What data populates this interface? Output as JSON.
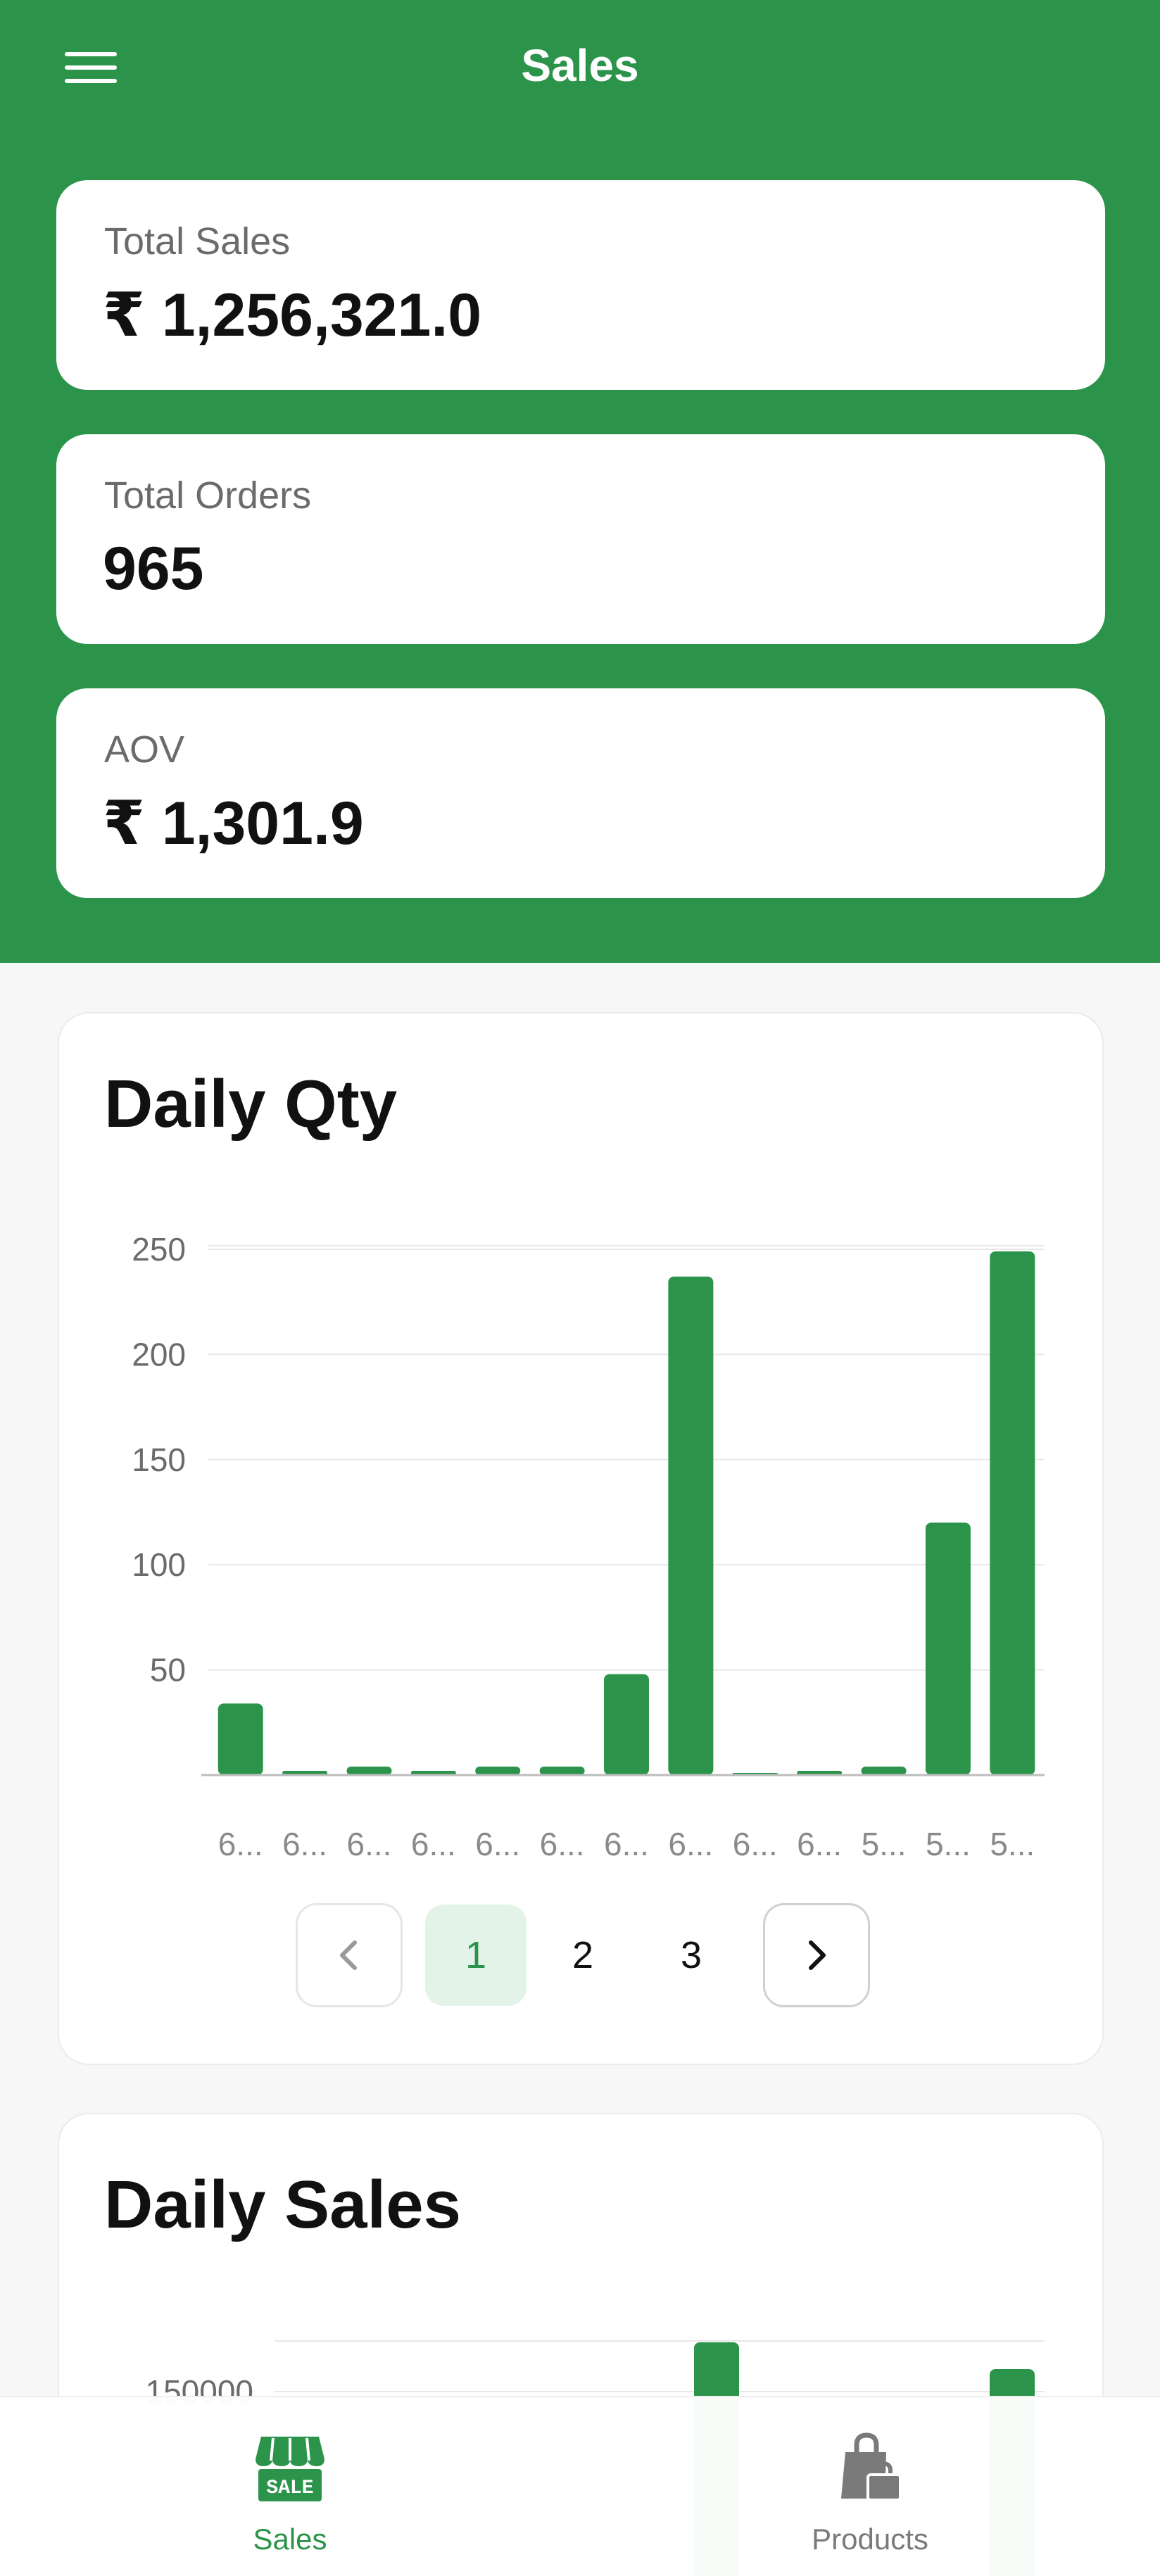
{
  "header": {
    "title": "Sales",
    "menu_icon": "hamburger-menu-icon"
  },
  "stats": [
    {
      "label": "Total Sales",
      "value": "₹ 1,256,321.0"
    },
    {
      "label": "Total Orders",
      "value": "965"
    },
    {
      "label": "AOV",
      "value": "₹ 1,301.9"
    }
  ],
  "daily_qty": {
    "title": "Daily Qty",
    "pagination": {
      "prev_icon": "chevron-left-icon",
      "next_icon": "chevron-right-icon",
      "pages": [
        "1",
        "2",
        "3"
      ],
      "current": "1"
    }
  },
  "daily_sales": {
    "title": "Daily Sales"
  },
  "nav": [
    {
      "label": "Sales",
      "icon": "sale-store-icon",
      "active": true
    },
    {
      "label": "Products",
      "icon": "shopping-bags-icon",
      "active": false
    }
  ],
  "colors": {
    "brand": "#2c944a",
    "active_page_bg": "#e4f3e8",
    "inactive_nav": "#7a7a7a"
  },
  "chart_data": [
    {
      "type": "bar",
      "title": "Daily Qty",
      "categories": [
        "6...",
        "6...",
        "6...",
        "6...",
        "6...",
        "6...",
        "6...",
        "6...",
        "6...",
        "6...",
        "5...",
        "5...",
        "5..."
      ],
      "values": [
        34,
        2,
        4,
        2,
        4,
        4,
        48,
        237,
        1,
        2,
        4,
        120,
        249
      ],
      "yticks": [
        50,
        100,
        150,
        200,
        250
      ],
      "ylim": [
        0,
        250
      ],
      "grid": true,
      "color": "#2c944a"
    },
    {
      "type": "bar",
      "title": "Daily Sales",
      "yticks": [
        150000
      ],
      "values_visible_partially": true,
      "color": "#2c944a"
    }
  ]
}
